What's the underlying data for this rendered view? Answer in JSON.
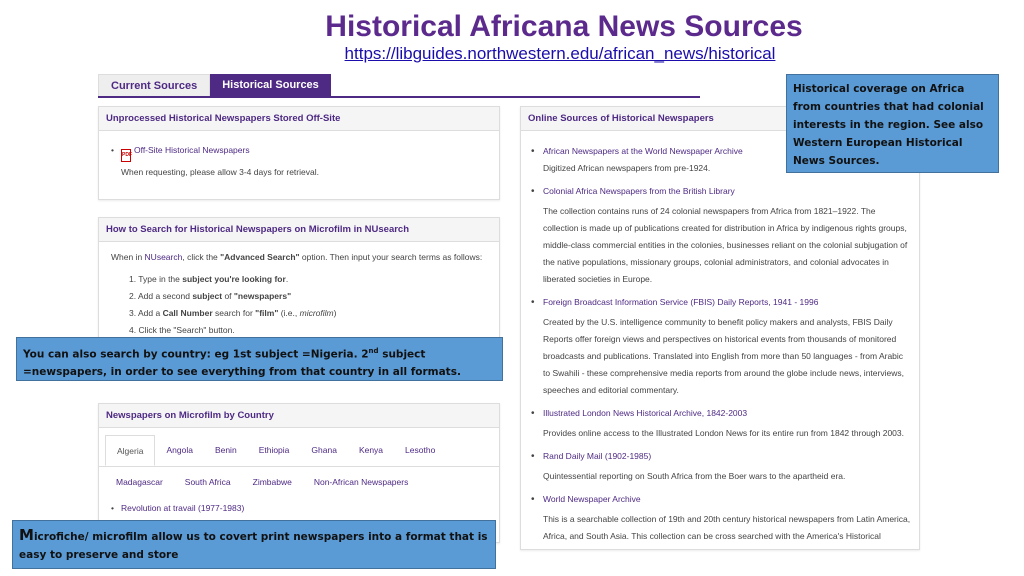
{
  "slide": {
    "title": "Historical Africana News Sources",
    "url": "https://libguides.northwestern.edu/african_news/historical"
  },
  "tabs": [
    {
      "label": "Current Sources",
      "active": false
    },
    {
      "label": "Historical Sources",
      "active": true
    }
  ],
  "offsite_panel": {
    "title": "Unprocessed Historical Newspapers Stored Off-Site",
    "item_link": "Off-Site Historical Newspapers",
    "item_note": "When requesting, please allow 3-4 days for retrieval."
  },
  "search_panel": {
    "title": "How to Search for Historical Newspapers on Microfilm in NUsearch",
    "intro_1": "When in ",
    "intro_link": "NUsearch",
    "intro_2": ", click the ",
    "intro_bold": "\"Advanced Search\"",
    "intro_3": " option. Then input your search terms as follows:",
    "step1_a": "1. Type in the ",
    "step1_b": "subject you're looking for",
    "step1_c": ".",
    "step2_a": "2. Add a second ",
    "step2_b": "subject",
    "step2_c": " of ",
    "step2_d": "\"newspapers\"",
    "step3_a": "3. Add a ",
    "step3_b": "Call Number",
    "step3_c": " search for ",
    "step3_d": "\"film\"",
    "step3_e": " (i.e., ",
    "step3_f": "microfilm",
    "step3_g": ")",
    "step4": "4. Click the \"Search\" button."
  },
  "country_panel": {
    "title": "Newspapers on Microfilm by Country",
    "tabs_row1": [
      "Algeria",
      "Angola",
      "Benin",
      "Ethiopia",
      "Ghana",
      "Kenya",
      "Lesotho"
    ],
    "tabs_row2": [
      "Madagascar",
      "South Africa",
      "Zimbabwe",
      "Non-African Newspapers"
    ],
    "first_item": "Revolution at travail (1977-1983)"
  },
  "online_panel": {
    "title": "Online Sources of Historical Newspapers",
    "items": [
      {
        "title": "African Newspapers at the World Newspaper Archive",
        "desc": "Digitized African newspapers from pre-1924."
      },
      {
        "title": "Colonial Africa Newspapers from the British Library",
        "desc": "The collection contains runs of 24 colonial newspapers from Africa from 1821–1922. The collection is made up of publications created for distribution in Africa by indigenous rights groups, middle-class commercial entities in the colonies, businesses reliant on the colonial subjugation of the native populations, missionary groups, colonial administrators, and colonial advocates in liberated societies in Europe."
      },
      {
        "title": "Foreign Broadcast Information Service (FBIS) Daily Reports, 1941 - 1996",
        "desc": "Created by the U.S. intelligence community to benefit policy makers and analysts, FBIS Daily Reports offer foreign views and perspectives on historical events from thousands of monitored broadcasts and publications. Translated into English from more than 50 languages - from Arabic to Swahili - these comprehensive media reports from around the globe include news, interviews, speeches and editorial commentary."
      },
      {
        "title": "Illustrated London News Historical Archive, 1842-2003",
        "desc": "Provides online access to the Illustrated London News for its entire run from 1842 through 2003."
      },
      {
        "title": "Rand Daily Mail (1902-1985)",
        "desc": "Quintessential reporting on South Africa from the Boer wars to the apartheid era."
      },
      {
        "title": "World Newspaper Archive",
        "desc": "This is a searchable collection of 19th and 20th century historical newspapers from Latin America, Africa, and South Asia. This collection can be cross searched with the America's Historical"
      }
    ]
  },
  "callouts": {
    "right": "Historical coverage on Africa from countries that had colonial interests in the region. See also Western European Historical News Sources.",
    "country_a": "You can also search by country: eg 1st subject =Nigeria. 2",
    "country_sup": "nd",
    "country_b": " subject =newspapers, in order to see everything from that country in all formats.",
    "micro_cap": "M",
    "micro_rest": "icrofiche/ microfilm allow us to covert print newspapers into a format that is easy to preserve and store"
  },
  "colors": {
    "accent": "#4e2a84",
    "title": "#5b2a8c",
    "callout": "#5b9bd5"
  },
  "icons": {
    "pdf": "pdf-file-icon"
  }
}
